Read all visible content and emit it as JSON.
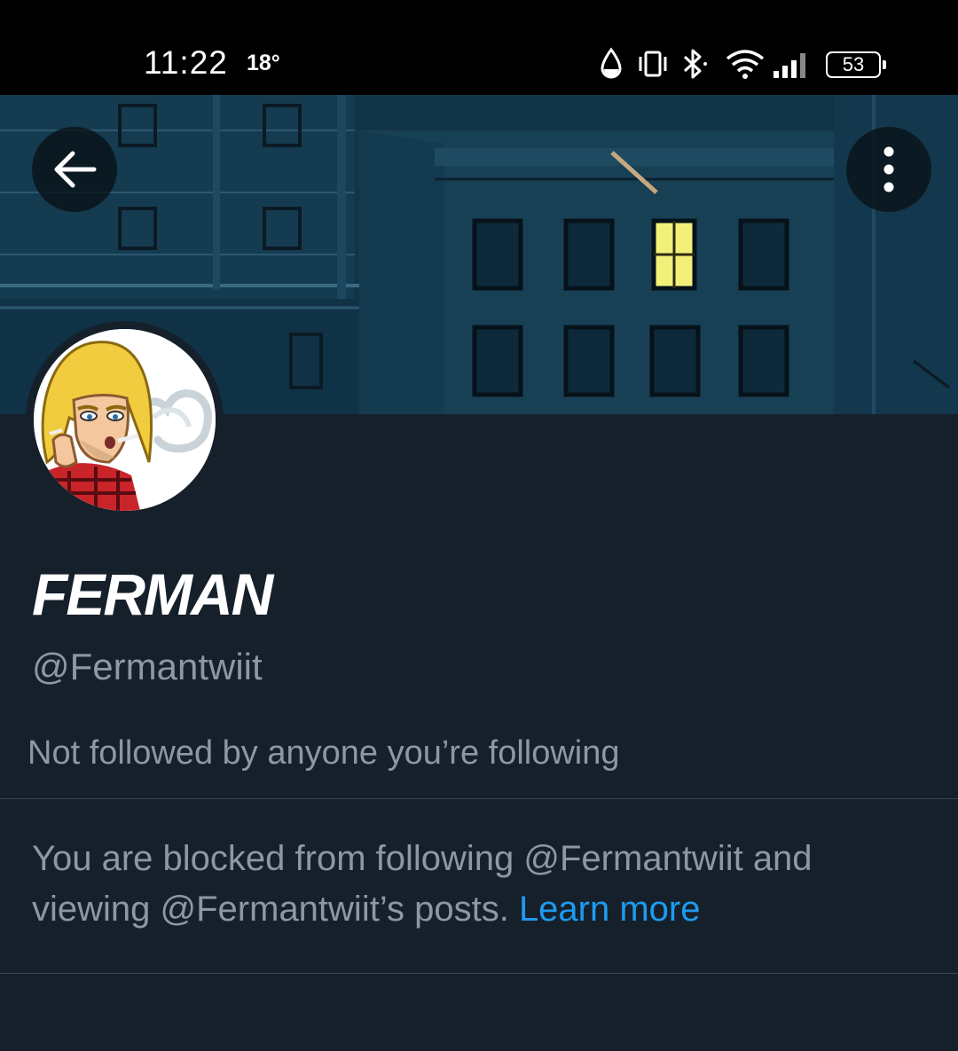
{
  "status_bar": {
    "time": "11:22",
    "temperature": "18°",
    "battery": "53",
    "icons": [
      "drop-icon",
      "vibrate-icon",
      "bluetooth-icon",
      "wifi-icon",
      "signal-icon",
      "battery-icon"
    ]
  },
  "header": {
    "back_icon": "arrow-left-icon",
    "more_icon": "more-vertical-icon"
  },
  "profile": {
    "display_name": "FERMAN",
    "handle": "@Fermantwiit",
    "followed_by": "Not followed by anyone you’re following"
  },
  "notice": {
    "message": "You are blocked from following @Fermantwiit and viewing @Fermantwiit’s posts.",
    "link_label": "Learn more"
  },
  "colors": {
    "background": "#15202b",
    "text_secondary": "#8b98a5",
    "link": "#1d9bf0",
    "divider": "#38444d"
  }
}
